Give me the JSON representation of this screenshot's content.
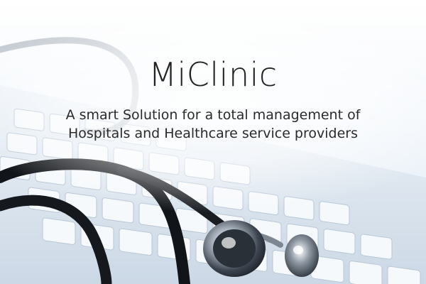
{
  "hero": {
    "title": "MiClinic",
    "subtitle_line1": "A smart Solution for a total management of",
    "subtitle_line2": "Hospitals and Healthcare service providers",
    "background_image": "stethoscope-on-keyboard",
    "colors": {
      "text": "#222222",
      "background_top": "#ffffff",
      "background_bottom": "#dfe9f4"
    }
  }
}
